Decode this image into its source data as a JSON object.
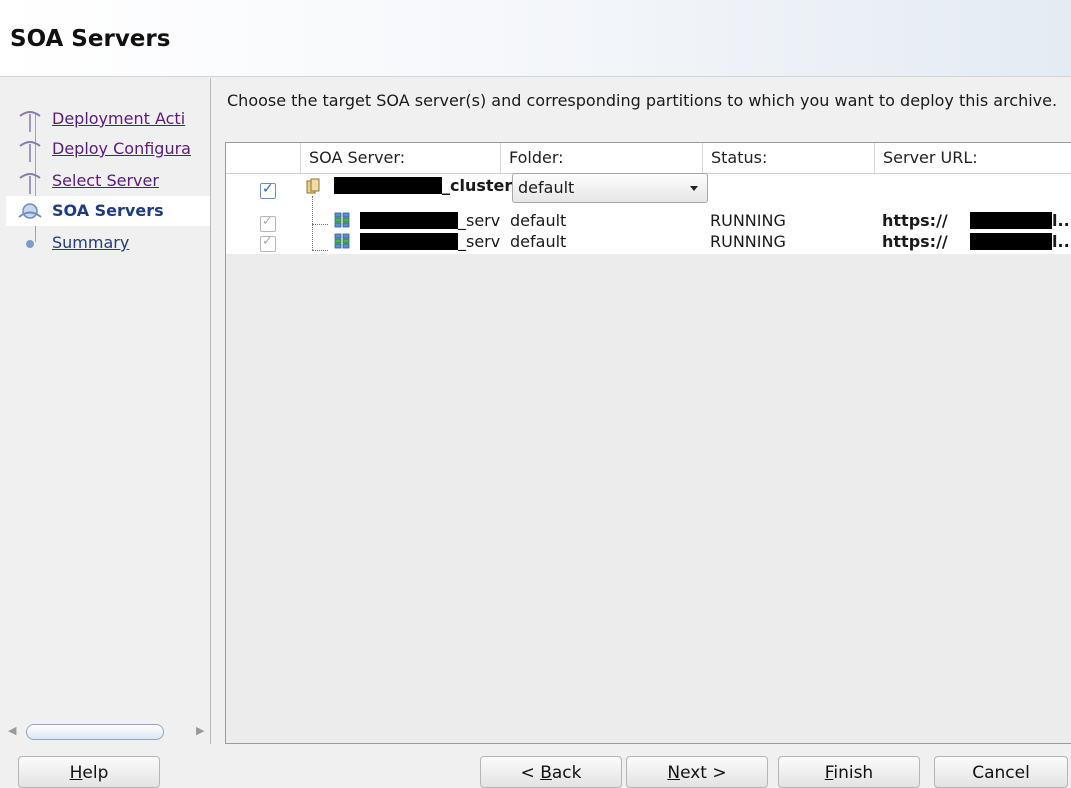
{
  "page": {
    "title": "SOA Servers"
  },
  "nav": {
    "items": [
      {
        "label": "Deployment Acti",
        "state": "visited"
      },
      {
        "label": "Deploy Configura",
        "state": "visited"
      },
      {
        "label": "Select Server",
        "state": "visited"
      },
      {
        "label": "SOA Servers",
        "state": "current"
      },
      {
        "label": "Summary",
        "state": "future"
      }
    ]
  },
  "instruction": "Choose the target SOA server(s) and corresponding partitions to which you want to deploy this archive.",
  "table": {
    "columns": [
      "SOA Server:",
      "Folder:",
      "Status:",
      "Server URL:"
    ],
    "rows": [
      {
        "checked": true,
        "enabled": true,
        "icon": "cluster-icon",
        "name_suffix": "_cluster",
        "folder": "default",
        "folder_is_dropdown": true,
        "status": "",
        "url_prefix": "",
        "url_suffix": ""
      },
      {
        "checked": true,
        "enabled": false,
        "icon": "server-icon",
        "name_suffix": "_serv",
        "folder": "default",
        "folder_is_dropdown": false,
        "status": "RUNNING",
        "url_prefix": "https://",
        "url_suffix": "l.."
      },
      {
        "checked": true,
        "enabled": false,
        "icon": "server-icon",
        "name_suffix": "_serv",
        "folder": "default",
        "folder_is_dropdown": false,
        "status": "RUNNING",
        "url_prefix": "https://",
        "url_suffix": "l.."
      }
    ]
  },
  "buttons": {
    "help": {
      "mnemonic": "H",
      "rest": "elp"
    },
    "back": {
      "pre": "< ",
      "mnemonic": "B",
      "rest": "ack"
    },
    "next": {
      "mnemonic": "N",
      "rest": "ext >"
    },
    "finish": {
      "mnemonic": "F",
      "rest": "inish"
    },
    "cancel": {
      "label": "Cancel"
    }
  },
  "colors": {
    "visited_link": "#5a1c7a",
    "current_step": "#1f3c80",
    "redaction": "#000000"
  }
}
